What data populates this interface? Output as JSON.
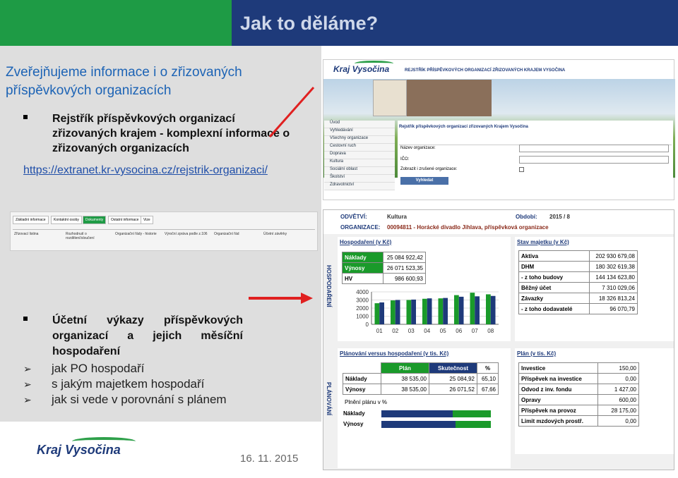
{
  "header": {
    "title": "Jak to děláme?"
  },
  "intro": {
    "heading": "Zveřejňujeme informace i o zřizovaných příspěvkových organizacích"
  },
  "bullet1": {
    "text": "Rejstřík příspěvkových organizací zřizovaných krajem - komplexní informace o zřizovaných organizacích",
    "link": "https://extranet.kr-vysocina.cz/rejstrik-organizaci/"
  },
  "bullet2": {
    "text": "Účetní výkazy příspěvkových organizací a jejich měsíční hospodaření",
    "items": [
      "jak PO hospodaří",
      "s jakým majetkem hospodaří",
      "jak si vede v porovnání s plánem"
    ]
  },
  "footer": {
    "date": "16. 11. 2015",
    "logo": "Kraj Vysočina"
  },
  "colors": {
    "green": "#1e9b45",
    "navy": "#1e3a7a",
    "red": "#e02020",
    "bar_green": "#1a9a2a"
  },
  "screen1": {
    "logo": "Kraj Vysočina",
    "banner": "REJSTŘÍK PŘÍSPĚVKOVÝCH ORGANIZACÍ ZŘIZOVANÝCH KRAJEM VYSOČINA",
    "menu": [
      "Úvod",
      "Vyhledávání",
      "Všechny organizace",
      "Cestovní ruch",
      "Doprava",
      "Kultura",
      "Sociální oblast",
      "Školství",
      "Zdravotnictví"
    ],
    "main_title": "Rejstřík příspěvkových organizací zřizovaných Krajem Vysočina",
    "field_name": "Název organizace:",
    "field_ico": "IČO:",
    "checkbox": "Zobrazit i zrušené organizace:",
    "search_btn": "Vyhledat"
  },
  "screen2": {
    "tabs": [
      "Základní informace",
      "Kontaktní osoby",
      "Dokumenty",
      "Ostatní informace",
      "Vize"
    ],
    "cells": [
      "Zřizovací listina",
      "Rozhodnutí o rozdělení/sloučení",
      "Organizační řády - historie",
      "Výroční zpráva podle z.106",
      "Organizační řád",
      "Účetní závěrky"
    ]
  },
  "screen3": {
    "odvetvi_label": "ODVĚTVÍ:",
    "odvetvi_value": "Kultura",
    "obdobi_label": "Období:",
    "obdobi_value": "2015 / 8",
    "org_label": "ORGANIZACE:",
    "org_value": "00094811 - Horácké divadlo Jihlava, příspěvková organizace",
    "hosp": {
      "title": "Hospodaření (v Kč)",
      "vertical": "HOSPODAŘENÍ",
      "rows": [
        {
          "label": "Náklady",
          "value": "25 084 922,42"
        },
        {
          "label": "Výnosy",
          "value": "26 071 523,35"
        },
        {
          "label": "HV",
          "value": "986 600,93"
        }
      ]
    },
    "stav": {
      "title": "Stav majetku (v Kč)",
      "rows": [
        {
          "label": "Aktiva",
          "value": "202 930 679,08"
        },
        {
          "label": "DHM",
          "value": "180 302 619,38"
        },
        {
          "label": "- z toho budovy",
          "value": "144 134 623,80"
        },
        {
          "label": "Běžný účet",
          "value": "7 310 029,06"
        },
        {
          "label": "Závazky",
          "value": "18 326 813,24"
        },
        {
          "label": "- z toho dodavatelé",
          "value": "96 070,79"
        }
      ]
    },
    "plan_vs": {
      "title": "Plánování versus hospodaření (v tis. Kč)",
      "vertical": "PLÁNOVÁNÍ",
      "headers": [
        "Plán",
        "Skutečnost",
        "%"
      ],
      "rows": [
        {
          "label": "Náklady",
          "plan": "38 535,00",
          "real": "25 084,92",
          "pct": "65,10"
        },
        {
          "label": "Výnosy",
          "plan": "38 535,00",
          "real": "26 071,52",
          "pct": "67,66"
        }
      ],
      "plneni_label": "Plnění plánu v %",
      "plneni": [
        {
          "label": "Náklady",
          "value": 65.1
        },
        {
          "label": "Výnosy",
          "value": 67.66
        }
      ]
    },
    "plan": {
      "title": "Plán (v tis. Kč)",
      "rows": [
        {
          "label": "Investice",
          "value": "150,00"
        },
        {
          "label": "Příspěvek na investice",
          "value": "0,00"
        },
        {
          "label": "Odvod z inv. fondu",
          "value": "1 427,00"
        },
        {
          "label": "Opravy",
          "value": "600,00"
        },
        {
          "label": "Příspěvek na provoz",
          "value": "28 175,00"
        },
        {
          "label": "Limit mzdových prostř.",
          "value": "0,00"
        }
      ]
    }
  },
  "chart_data": {
    "type": "bar",
    "categories": [
      "01",
      "02",
      "03",
      "04",
      "05",
      "06",
      "07",
      "08"
    ],
    "series": [
      {
        "values": [
          2600,
          2950,
          3000,
          3150,
          3200,
          3600,
          3900,
          3700
        ]
      },
      {
        "values": [
          2700,
          3000,
          3050,
          3200,
          3250,
          3400,
          3450,
          3500
        ]
      }
    ],
    "ylim": [
      0,
      4000
    ],
    "yticks": [
      "4000",
      "3000",
      "2000",
      "1000",
      "0"
    ]
  }
}
